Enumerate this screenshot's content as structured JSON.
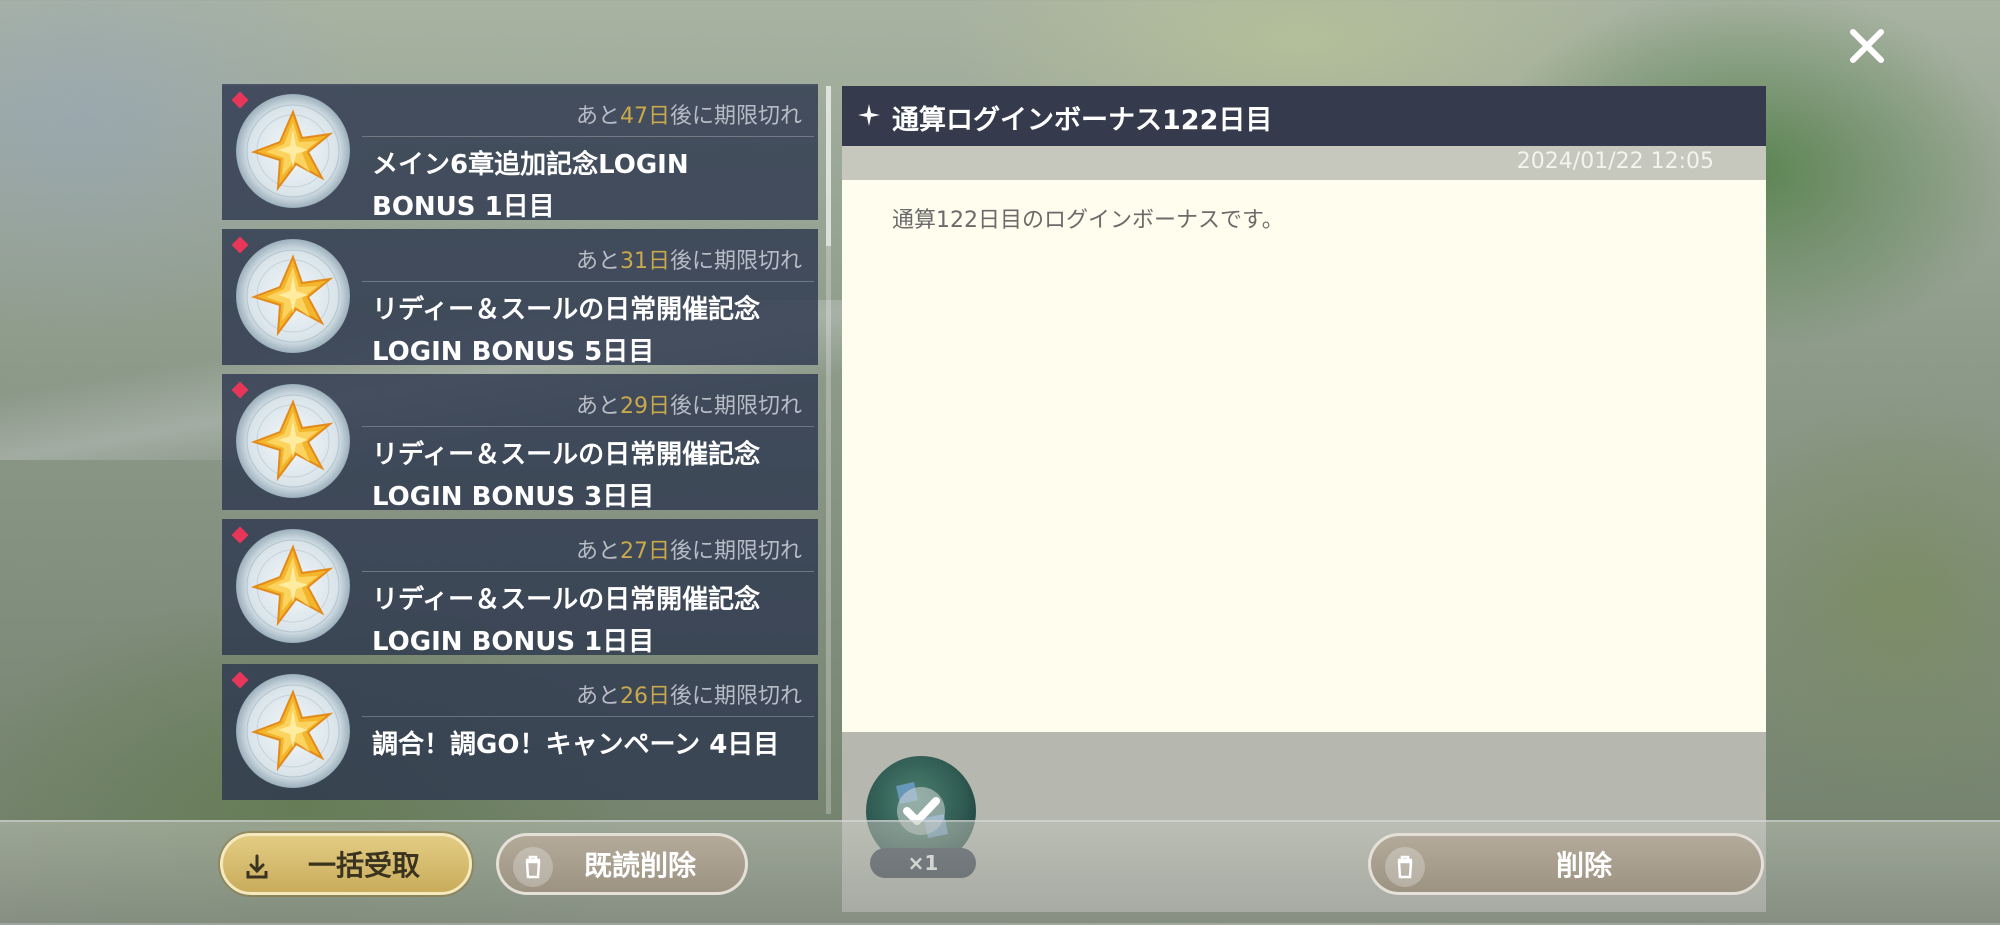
{
  "close_button": {
    "icon": "close-icon"
  },
  "mail_list": [
    {
      "expire_prefix": "あと",
      "expire_days": "47日",
      "expire_suffix": "後に期限切れ",
      "title_line1": "メイン6章追加記念LOGIN",
      "title_line2": "BONUS 1日目",
      "unread": true
    },
    {
      "expire_prefix": "あと",
      "expire_days": "31日",
      "expire_suffix": "後に期限切れ",
      "title_line1": "リディー＆スールの日常開催記念",
      "title_line2": "LOGIN BONUS 5日目",
      "unread": true
    },
    {
      "expire_prefix": "あと",
      "expire_days": "29日",
      "expire_suffix": "後に期限切れ",
      "title_line1": "リディー＆スールの日常開催記念",
      "title_line2": "LOGIN BONUS 3日目",
      "unread": true
    },
    {
      "expire_prefix": "あと",
      "expire_days": "27日",
      "expire_suffix": "後に期限切れ",
      "title_line1": "リディー＆スールの日常開催記念",
      "title_line2": "LOGIN BONUS 1日目",
      "unread": true
    },
    {
      "expire_prefix": "あと",
      "expire_days": "26日",
      "expire_suffix": "後に期限切れ",
      "title_line1": "調合！調GO！キャンペーン 4日目",
      "title_line2": "",
      "unread": true
    }
  ],
  "detail": {
    "title": "通算ログインボーナス122日目",
    "date": "2024/01/22 12:05",
    "message": "通算122日目のログインボーナスです。",
    "reward": {
      "quantity": "×1",
      "icon": "reward-received-icon"
    }
  },
  "buttons": {
    "receive_all": "一括受取",
    "delete_read": "既読削除",
    "delete": "削除"
  },
  "colors": {
    "unread_marker": "#e8365a",
    "expire_days": "#c9a94c",
    "header_bg": "#353b4c",
    "body_bg": "#fefdee",
    "primary_button": "#d9bf70"
  }
}
